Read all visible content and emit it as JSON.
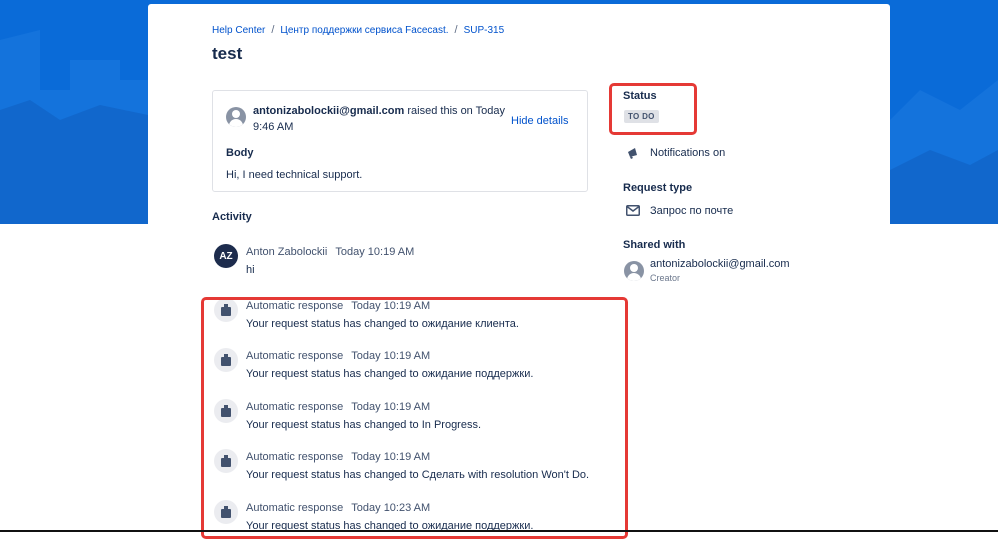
{
  "breadcrumb": {
    "home": "Help Center",
    "separator": "/",
    "project": "Центр поддержки сервиса Facecast.",
    "issue": "SUP-315"
  },
  "page_title": "test",
  "request": {
    "email": "antonizabolockii@gmail.com",
    "raised_text": "raised this on Today 9:46 AM",
    "hide_details": "Hide details",
    "body_label": "Body",
    "body_text": "Hi, I need technical support."
  },
  "activity": {
    "label": "Activity",
    "comment": {
      "initials": "AZ",
      "author": "Anton Zabolockii",
      "time": "Today 10:19 AM",
      "text": "hi"
    },
    "responses": [
      {
        "author": "Automatic response",
        "time": "Today 10:19 AM",
        "text": "Your request status has changed to ожидание клиента."
      },
      {
        "author": "Automatic response",
        "time": "Today 10:19 AM",
        "text": "Your request status has changed to ожидание поддержки."
      },
      {
        "author": "Automatic response",
        "time": "Today 10:19 AM",
        "text": "Your request status has changed to In Progress."
      },
      {
        "author": "Automatic response",
        "time": "Today 10:19 AM",
        "text": "Your request status has changed to Сделать with resolution Won't Do."
      },
      {
        "author": "Automatic response",
        "time": "Today 10:23 AM",
        "text": "Your request status has changed to ожидание поддержки."
      }
    ]
  },
  "sidebar": {
    "status_label": "Status",
    "status_value": "TO DO",
    "notifications": "Notifications on",
    "request_type_label": "Request type",
    "request_type_value": "Запрос по почте",
    "shared_with_label": "Shared with",
    "shared_email": "antonizabolockii@gmail.com",
    "shared_role": "Creator"
  },
  "colors": {
    "hero_blue": "#0a6bd8",
    "link": "#0052cc",
    "highlight_red": "#e53935"
  }
}
